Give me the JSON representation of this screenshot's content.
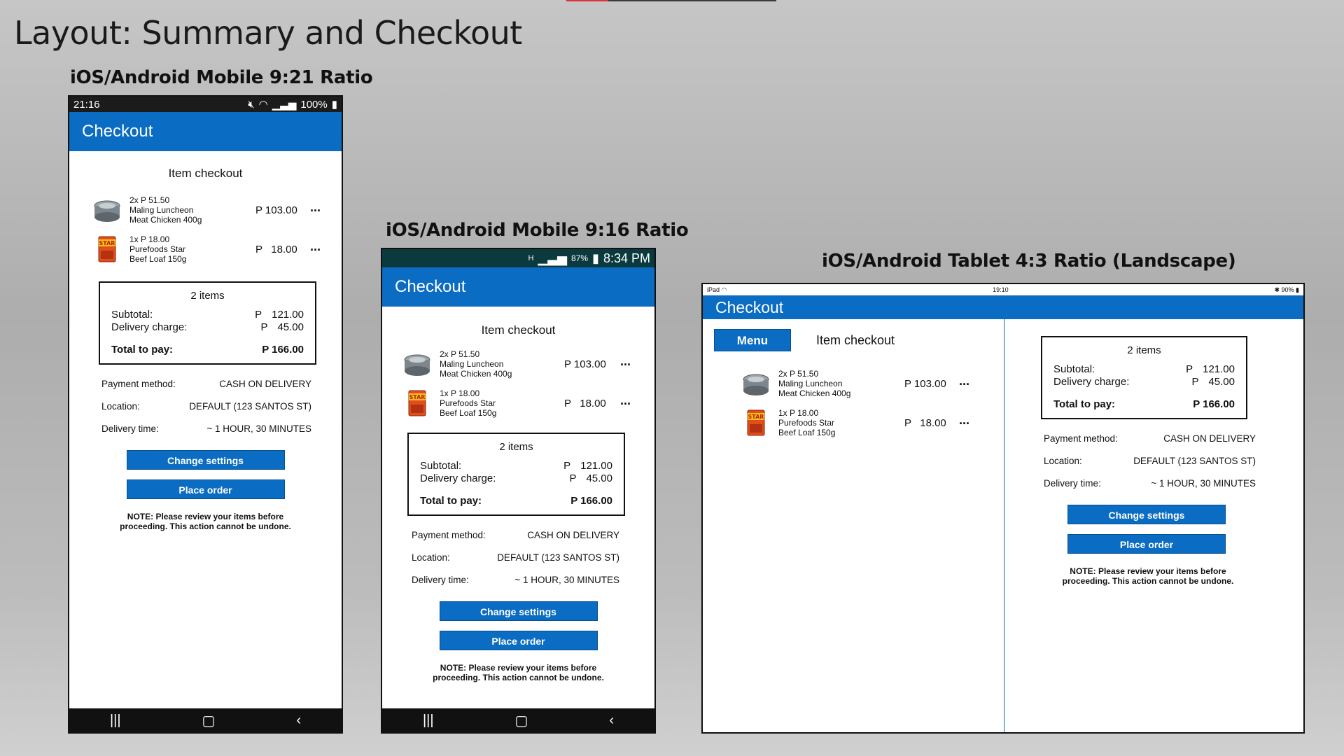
{
  "slide": {
    "title": "Layout: Summary and Checkout",
    "captions": {
      "mobile_921": "iOS/Android Mobile 9:21 Ratio",
      "mobile_916": "iOS/Android Mobile 9:16 Ratio",
      "tablet_43": "iOS/Android Tablet 4:3 Ratio (Landscape)"
    }
  },
  "checkout": {
    "app_title": "Checkout",
    "section_title": "Item checkout",
    "menu_label": "Menu",
    "items": [
      {
        "qty_price": "2x P 51.50",
        "name_line1": "Maling Luncheon",
        "name_line2": "Meat Chicken 400g",
        "total": "P 103.00",
        "more": "..."
      },
      {
        "qty_price": "1x P 18.00",
        "name_line1": "Purefoods Star",
        "name_line2": "Beef Loaf 150g",
        "total": "P   18.00",
        "more": "..."
      }
    ],
    "summary": {
      "count": "2 items",
      "subtotal_label": "Subtotal:",
      "subtotal_currency": "P",
      "subtotal_value": "121.00",
      "delivery_label": "Delivery charge:",
      "delivery_currency": "P",
      "delivery_value": "45.00",
      "total_label": "Total to pay:",
      "total_value": "P 166.00"
    },
    "info": {
      "payment_label": "Payment method:",
      "payment_value": "CASH ON DELIVERY",
      "location_label": "Location:",
      "location_value": "DEFAULT (123 SANTOS ST)",
      "time_label": "Delivery time:",
      "time_value": "~ 1 HOUR, 30 MINUTES"
    },
    "change_settings_label": "Change settings",
    "place_order_label": "Place order",
    "note_line1": "NOTE: Please review your items before",
    "note_line2": "proceeding. This action cannot be undone."
  },
  "status": {
    "m1_time": "21:16",
    "m1_battery": "100%",
    "m2_battery": "87%",
    "m2_time": "8:34 PM",
    "tab_left": "iPad",
    "tab_time": "19:10",
    "tab_battery": "90%"
  },
  "colors": {
    "accent": "#0a6cc2",
    "status_dark": "#1b1b1b",
    "status_teal": "#0b3a3e"
  }
}
